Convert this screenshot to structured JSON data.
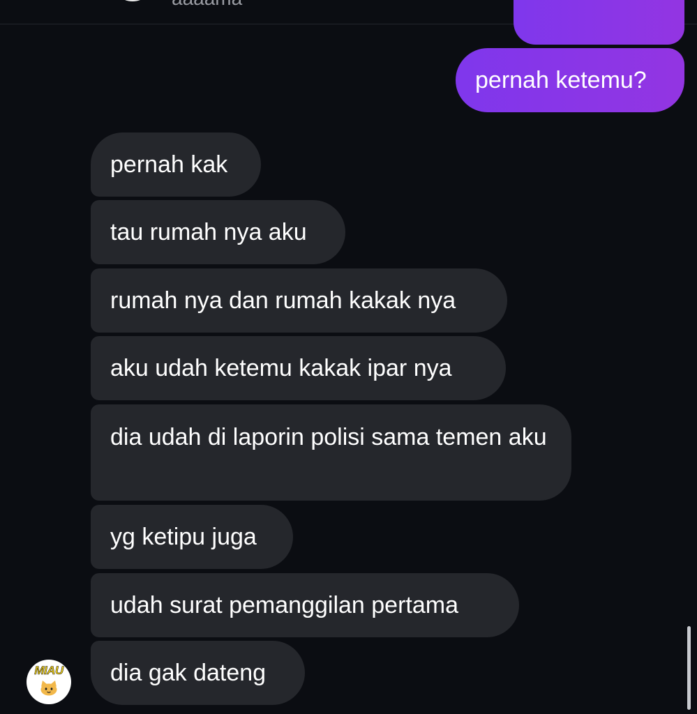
{
  "header": {
    "username": "aaaama"
  },
  "sent_messages": [
    {
      "text": ""
    },
    {
      "text": "pernah ketemu?"
    }
  ],
  "received_messages": [
    {
      "text": "pernah kak"
    },
    {
      "text": "tau rumah nya aku"
    },
    {
      "text": "rumah nya dan rumah kakak nya"
    },
    {
      "text": "aku udah ketemu kakak ipar nya"
    },
    {
      "text": "dia udah di laporin polisi sama temen aku"
    },
    {
      "text": "yg ketipu juga"
    },
    {
      "text": "udah surat pemanggilan pertama"
    },
    {
      "text": "dia gak dateng"
    }
  ],
  "sender_avatar": {
    "label": "MIAU",
    "icon": "cat-face-icon"
  },
  "colors": {
    "background": "#0b0d12",
    "sent_bubble": "#8b34e9",
    "received_bubble": "#25272c",
    "text": "#ffffff"
  }
}
